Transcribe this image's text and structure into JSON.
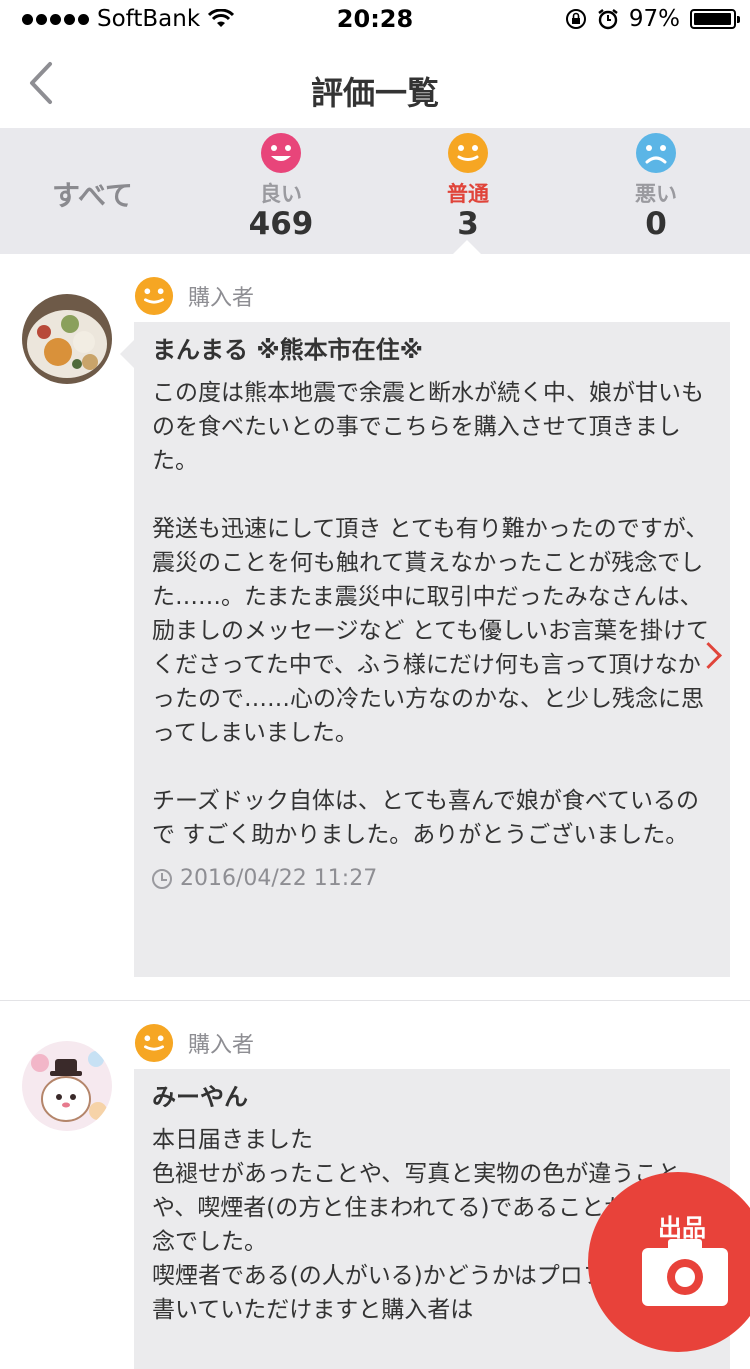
{
  "status_bar": {
    "carrier": "SoftBank",
    "time": "20:28",
    "battery": "97%",
    "battery_level": 0.97
  },
  "nav": {
    "title": "評価一覧"
  },
  "tabs": {
    "all_label": "すべて",
    "items": [
      {
        "label": "良い",
        "count": "469",
        "color": "#e8457a"
      },
      {
        "label": "普通",
        "count": "3",
        "color": "#f6a623"
      },
      {
        "label": "悪い",
        "count": "0",
        "color": "#5bb5e6"
      }
    ],
    "active_color": "#e0443a"
  },
  "reviews": [
    {
      "role": "購入者",
      "name": "まんまる ※熊本市在住※",
      "text": "この度は熊本地震で余震と断水が続く中、娘が甘いものを食べたいとの事でこちらを購入させて頂きました。\n\n発送も迅速にして頂き とても有り難かったのですが、震災のことを何も触れて貰えなかったことが残念でした……。たまたま震災中に取引中だったみなさんは、励ましのメッセージなど とても優しいお言葉を掛けてくださってた中で、ふう様にだけ何も言って頂けなかったので……心の冷たい方なのかな、と少し残念に思ってしまいました。\n\nチーズドック自体は、とても喜んで娘が食べているので すごく助かりました。ありがとうございました。",
      "date": "2016/04/22 11:27"
    },
    {
      "role": "購入者",
      "name": "みーやん",
      "text": "本日届きました\n色褪せがあったことや、写真と実物の色が違うことや、喫煙者(の方と住まわれてる)であることが少し残念でした。\n喫煙者である(の人がいる)かどうかはプロフィールに書いていただけますと購入者は"
    }
  ],
  "fab": {
    "label": "出品",
    "color": "#e8423a"
  }
}
